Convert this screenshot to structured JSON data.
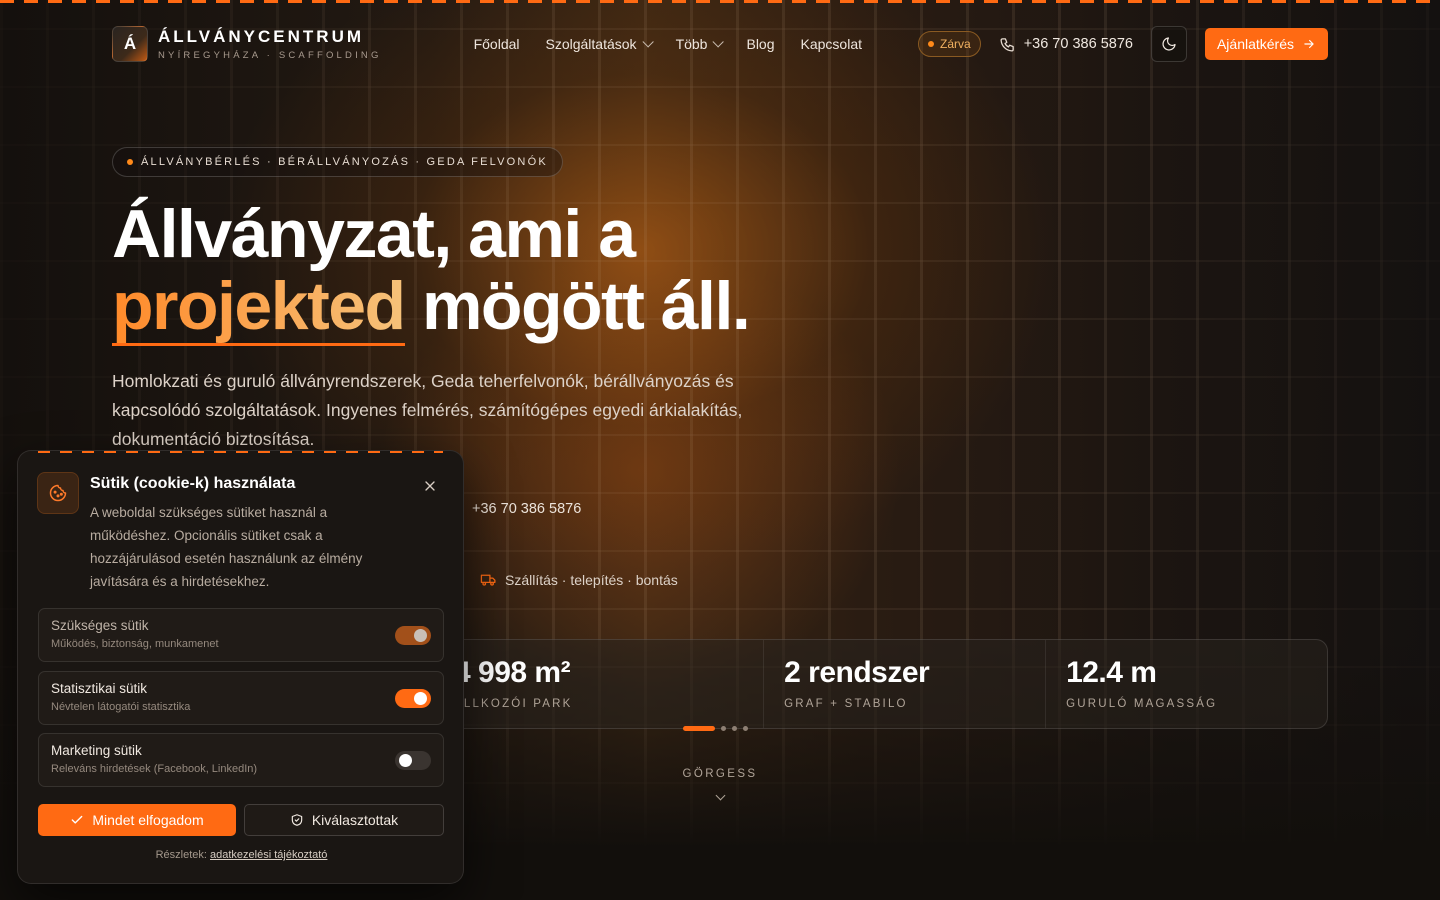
{
  "colors": {
    "accent": "#ff6a13",
    "background": "#0f0c0a"
  },
  "brand": {
    "mark": "Á",
    "name": "ÁLLVÁNYCENTRUM",
    "subtitle": "NYÍREGYHÁZA · SCAFFOLDING"
  },
  "nav": {
    "items": [
      {
        "label": "Főoldal"
      },
      {
        "label": "Szolgáltatások"
      },
      {
        "label": "Több"
      },
      {
        "label": "Blog"
      },
      {
        "label": "Kapcsolat"
      }
    ]
  },
  "header": {
    "status": "Zárva",
    "phone": "+36 70 386 5876",
    "theme_icon": "moon-icon",
    "cta": "Ajánlatkérés"
  },
  "hero": {
    "eyebrow": "ÁLLVÁNYBÉRLÉS · BÉRÁLLVÁNYOZÁS · GEDA FELVONÓK",
    "headline_line1": "Állványzat, ami a",
    "headline_highlight": "projekted",
    "headline_rest": " mögött áll.",
    "lead": "Homlokzati és guruló állványrendszerek, Geda teherfelvonók, bérállványozás és kapcsolódó szolgáltatások. Ingyenes felmérés, számítógépes egyedi árkialakítás, dokumentáció biztosítása.",
    "phone": "+36 70 386 5876",
    "feature": "Szállítás · telepítés · bontás"
  },
  "stats": [
    {
      "value": "4 998 m²",
      "label": "ALLKOZÓI PARK"
    },
    {
      "value": "2 rendszer",
      "label": "GRAF + STABILO"
    },
    {
      "value": "12.4 m",
      "label": "GURULÓ MAGASSÁG"
    }
  ],
  "scroll": {
    "label": "GÖRGESS"
  },
  "cookie": {
    "title": "Sütik (cookie-k) használata",
    "description": "A weboldal szükséges sütiket használ a működéshez. Opcionális sütiket csak a hozzájárulásod esetén használunk az élmény javítására és a hirdetésekhez.",
    "prefs": [
      {
        "title": "Szükséges sütik",
        "subtitle": "Működés, biztonság, munkamenet",
        "state": "locked"
      },
      {
        "title": "Statisztikai sütik",
        "subtitle": "Névtelen látogatói statisztika",
        "state": "on"
      },
      {
        "title": "Marketing sütik",
        "subtitle": "Releváns hirdetések (Facebook, LinkedIn)",
        "state": "off"
      }
    ],
    "accept_all": "Mindet elfogadom",
    "accept_selected": "Kiválasztottak",
    "footer_prefix": "Részletek:",
    "footer_link": "adatkezelési tájékoztató"
  }
}
